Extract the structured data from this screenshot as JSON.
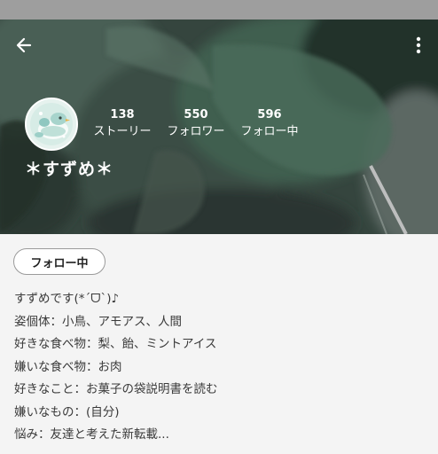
{
  "header": {
    "back_icon": "arrow-back-icon",
    "more_icon": "more-vert-icon",
    "avatar_icon": "bird-avatar-icon",
    "display_name": "＊すずめ＊",
    "stats": [
      {
        "value": "138",
        "label": "ストーリー"
      },
      {
        "value": "550",
        "label": "フォロワー"
      },
      {
        "value": "596",
        "label": "フォロー中"
      }
    ]
  },
  "actions": {
    "follow_label": "フォロー中"
  },
  "bio": {
    "lines": [
      "すずめです(*´ᗜ`)♪",
      "姿個体：小鳥、アモアス、人間",
      "好きな食べ物：梨、飴、ミントアイス",
      "嫌いな食べ物：お肉",
      "好きなこと：お菓子の袋説明書を読む",
      "嫌いなもの：(自分)",
      "悩み：友達と考えた新転載..."
    ]
  },
  "colors": {
    "status_bar": "#9e9e9e",
    "header_bg": "#2c3a34",
    "page_bg": "#f4f4f4",
    "text": "#3a3a3a"
  }
}
